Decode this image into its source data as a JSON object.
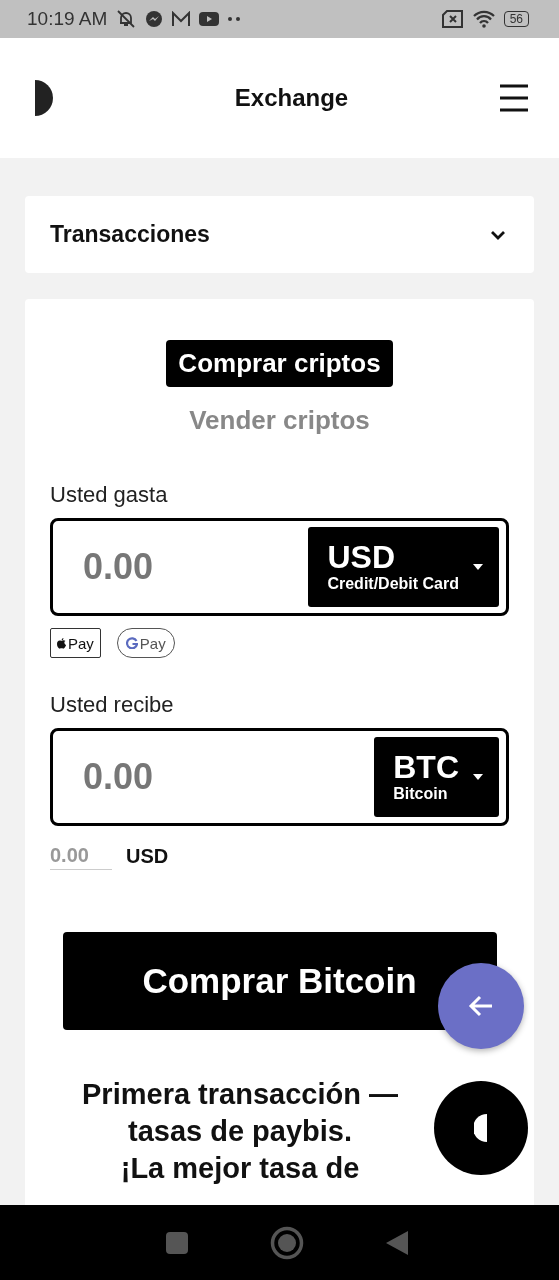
{
  "status_bar": {
    "time": "10:19 AM",
    "battery": "56"
  },
  "header": {
    "title": "Exchange"
  },
  "transactions": {
    "label": "Transacciones",
    "expanded": false
  },
  "tabs": [
    {
      "label": "Comprar criptos",
      "selected": true
    },
    {
      "label": "Vender criptos",
      "selected": false
    }
  ],
  "spend": {
    "label": "Usted gasta",
    "placeholder": "0.00",
    "currency": "USD",
    "method": "Credit/Debit Card"
  },
  "payment_badges": [
    {
      "kind": "apple",
      "label": "Pay"
    },
    {
      "kind": "google",
      "label": "Pay"
    }
  ],
  "receive": {
    "label": "Usted recibe",
    "placeholder": "0.00",
    "currency": "BTC",
    "name": "Bitcoin"
  },
  "equivalent": {
    "placeholder": "0.00",
    "currency": "USD"
  },
  "buy_button": "Comprar Bitcoin",
  "headline": [
    "Primera transacción —",
    "tasas de paybis.",
    "¡La mejor tasa de"
  ]
}
